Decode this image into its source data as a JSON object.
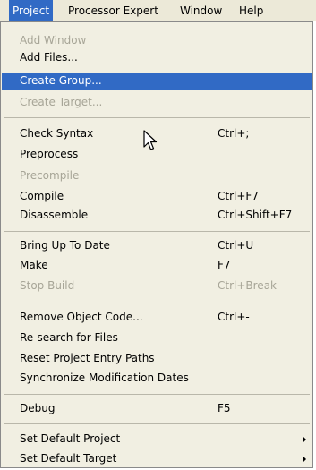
{
  "menubar": {
    "items": [
      "Project",
      "Processor Expert",
      "Window",
      "Help"
    ]
  },
  "menu": {
    "group1": [
      {
        "label": "Add Window",
        "shortcut": "",
        "disabled": true
      },
      {
        "label": "Add Files...",
        "shortcut": "",
        "disabled": false
      },
      {
        "label": "Create Group...",
        "shortcut": "",
        "disabled": false,
        "highlighted": true
      },
      {
        "label": "Create Target...",
        "shortcut": "",
        "disabled": true
      }
    ],
    "group2": [
      {
        "label": "Check Syntax",
        "shortcut": "Ctrl+;",
        "disabled": false
      },
      {
        "label": "Preprocess",
        "shortcut": "",
        "disabled": false
      },
      {
        "label": "Precompile",
        "shortcut": "",
        "disabled": true
      },
      {
        "label": "Compile",
        "shortcut": "Ctrl+F7",
        "disabled": false
      },
      {
        "label": "Disassemble",
        "shortcut": "Ctrl+Shift+F7",
        "disabled": false
      }
    ],
    "group3": [
      {
        "label": "Bring Up To Date",
        "shortcut": "Ctrl+U",
        "disabled": false
      },
      {
        "label": "Make",
        "shortcut": "F7",
        "disabled": false
      },
      {
        "label": "Stop Build",
        "shortcut": "Ctrl+Break",
        "disabled": true
      }
    ],
    "group4": [
      {
        "label": "Remove Object Code...",
        "shortcut": "Ctrl+-",
        "disabled": false
      },
      {
        "label": "Re-search for Files",
        "shortcut": "",
        "disabled": false
      },
      {
        "label": "Reset Project Entry Paths",
        "shortcut": "",
        "disabled": false
      },
      {
        "label": "Synchronize Modification Dates",
        "shortcut": "",
        "disabled": false
      }
    ],
    "group5": [
      {
        "label": "Debug",
        "shortcut": "F5",
        "disabled": false
      }
    ],
    "group6": [
      {
        "label": "Set Default Project",
        "shortcut": "",
        "submenu": true
      },
      {
        "label": "Set Default Target",
        "shortcut": "",
        "submenu": true
      }
    ]
  }
}
